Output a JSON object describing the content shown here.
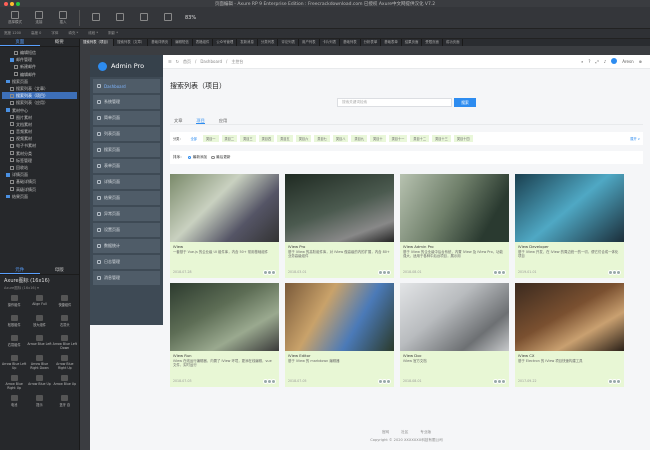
{
  "window": {
    "title": "页面编辑 - Axure RP 9 Enterprise Edition : Freecrackdownload.com 已授权    Axure中文网提供汉化 V7.2"
  },
  "toolbar": {
    "items": [
      "选择模式",
      "连接",
      "插入"
    ],
    "zoom": "83%"
  },
  "left_panel": {
    "tabs": [
      "页面",
      "概要"
    ],
    "tree": [
      {
        "label": "编辑短信",
        "level": 3,
        "type": "page"
      },
      {
        "label": "邮件管理",
        "level": 2,
        "type": "folder"
      },
      {
        "label": "新建邮件",
        "level": 3,
        "type": "page"
      },
      {
        "label": "编辑邮件",
        "level": 3,
        "type": "page"
      },
      {
        "label": "搜索页面",
        "level": 1,
        "type": "folder"
      },
      {
        "label": "搜索列表（文章）",
        "level": 2,
        "type": "page"
      },
      {
        "label": "搜索列表（项目）",
        "level": 2,
        "type": "page",
        "selected": true
      },
      {
        "label": "搜索列表（应用）",
        "level": 2,
        "type": "page"
      },
      {
        "label": "素材中心",
        "level": 1,
        "type": "folder"
      },
      {
        "label": "图片素材",
        "level": 2,
        "type": "page"
      },
      {
        "label": "文档素材",
        "level": 2,
        "type": "page"
      },
      {
        "label": "音频素材",
        "level": 2,
        "type": "page"
      },
      {
        "label": "视频素材",
        "level": 2,
        "type": "page"
      },
      {
        "label": "电子书素材",
        "level": 2,
        "type": "page"
      },
      {
        "label": "素材分类",
        "level": 2,
        "type": "page"
      },
      {
        "label": "标签管理",
        "level": 2,
        "type": "page"
      },
      {
        "label": "回收站",
        "level": 2,
        "type": "page"
      },
      {
        "label": "详情页面",
        "level": 1,
        "type": "folder"
      },
      {
        "label": "基础详情页",
        "level": 2,
        "type": "page"
      },
      {
        "label": "高级详情页",
        "level": 2,
        "type": "page"
      },
      {
        "label": "结果页面",
        "level": 1,
        "type": "folder"
      }
    ],
    "lib_tabs": [
      "元件",
      "母版"
    ],
    "lib_title": "Axure图标 (16x16)",
    "lib_sub": "Axure图标 (16x16) ▾",
    "lib_items": [
      "操作组件",
      "Align Full",
      "快捷组件",
      "松散组件",
      "放大组件",
      "右箭头",
      "右箭组件",
      "Arrow Blue Left",
      "Arrow Blue Left Down",
      "Arrow Blue Left Up",
      "Arrow Blue Right Down",
      "Arrow Blue Right Up",
      "Arrow Blue Right Up",
      "Arrow Blue Up",
      "Arrow Blue Up",
      "电池",
      "提示",
      "蓝牙 自"
    ]
  },
  "page_tabs": [
    "搜索列表（项目）",
    "搜索列表（文章）",
    "基础详情页",
    "编辑短信",
    "表格组件",
    "公众号管理",
    "发新消息",
    "分类列表",
    "评论列表",
    "用户列表",
    "卡片列表",
    "基础列表",
    "分析表单",
    "基础表单",
    "结果页面",
    "受限页面",
    "成功页面"
  ],
  "prop_bar": [
    "宽度 1200",
    "高度 0",
    "字体",
    "填充 *",
    "线段 *",
    "阴影 *"
  ],
  "app": {
    "brand": "Admin Pro",
    "menu": [
      "Dashboard",
      "系统管理",
      "简单页面",
      "列表页面",
      "搜索页面",
      "表单页面",
      "详情页面",
      "结果页面",
      "异常页面",
      "设置页面",
      "数据统计",
      "日志管理",
      "消息管理"
    ],
    "breadcrumb": [
      "首页",
      "Dashboard",
      "主控台"
    ],
    "user": "Aresn",
    "page_title": "搜索列表（项目）",
    "search_placeholder": "搜索关键词检索",
    "search_button": "搜索",
    "tabs": [
      "文章",
      "项目",
      "应用"
    ],
    "category_label": "分类：",
    "categories": [
      "全部",
      "类目一",
      "类目二",
      "类目三",
      "类目四",
      "类目五",
      "类目六",
      "类目七",
      "类目八",
      "类目九",
      "类目十",
      "类目十一",
      "类目十二",
      "类目十三",
      "类目十四"
    ],
    "category_more": "展开 ∨",
    "sort_label": "排序：",
    "sort_options": [
      "最新添加",
      "最后更新"
    ],
    "cards": [
      {
        "title": "iView",
        "desc": "一套基于 Vue.js 的企业级 UI 组件库，内含 50+ 常用基础组件",
        "date": "2018-07-28"
      },
      {
        "title": "iView Pro",
        "desc": "基于 iView 的高阶组件库，对 iView 做高级的内的扩展，内含 80+ 业务高级组件",
        "date": "2018-03-01"
      },
      {
        "title": "iView Admin Pro",
        "desc": "基于 iView 的企业级中后台系统，内置 iView 及 iView Pro，功能强大，适用于各种中后台项目，展示用",
        "date": "2018-08-01"
      },
      {
        "title": "iView Developer",
        "desc": "基于 iView 开发、在 iView 的周边统一的一切，便它们合成一体化项目",
        "date": "2019-01-01"
      },
      {
        "title": "iView Run",
        "desc": "iView 在线运行编辑器，内置了 iView 环境，更添在线编辑，vue 文件，实时运行",
        "date": "2018-07-03"
      },
      {
        "title": "iView Editor",
        "desc": "基于 iView 的 markdown 编辑器",
        "date": "2018-07-05"
      },
      {
        "title": "iView Doc",
        "desc": "iView 官方文档",
        "date": "2018-08-01"
      },
      {
        "title": "iView CX",
        "desc": "基于 Electron 的 iView 项目快速构建工具",
        "date": "2017-09-22"
      }
    ],
    "footer_links": [
      "官网",
      "社区",
      "专业版"
    ],
    "copyright": "Copyright © 2020 XXXXXXX科技有限公司"
  }
}
